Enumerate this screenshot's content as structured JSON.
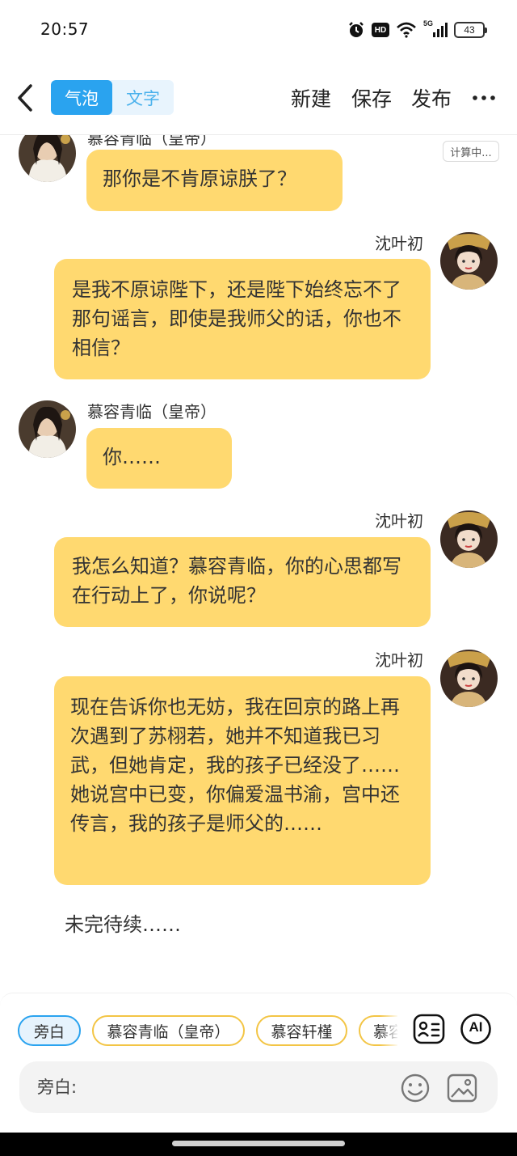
{
  "status_bar": {
    "time": "20:57",
    "network": "5G",
    "hd": "HD",
    "battery": "43"
  },
  "header": {
    "tabs": [
      {
        "label": "气泡",
        "active": true
      },
      {
        "label": "文字",
        "active": false
      }
    ],
    "new_label": "新建",
    "save_label": "保存",
    "publish_label": "发布",
    "accent_color": "#2aa3ef"
  },
  "chat": {
    "status_chip": "计算中...",
    "messages": [
      {
        "speaker": "慕容青临（皇帝）",
        "side": "left",
        "text": "那你是不肯原谅朕了？"
      },
      {
        "speaker": "沈叶初",
        "side": "right",
        "text": "是我不原谅陛下，还是陛下始终忘不了那句谣言，即使是我师父的话，你也不相信？"
      },
      {
        "speaker": "慕容青临（皇帝）",
        "side": "left",
        "text": "你……"
      },
      {
        "speaker": "沈叶初",
        "side": "right",
        "text": "我怎么知道？慕容青临，你的心思都写在行动上了，你说呢？"
      },
      {
        "speaker": "沈叶初",
        "side": "right",
        "text": "现在告诉你也无妨，我在回京的路上再次遇到了苏栩若，她并不知道我已习武，但她肯定，我的孩子已经没了……她说宫中已变，你偏爱温书渝，宫中还传言，我的孩子是师父的……"
      }
    ],
    "narration": "未完待续……",
    "bubble_color": "#ffd970"
  },
  "bottom": {
    "roles": [
      {
        "label": "旁白",
        "active": true
      },
      {
        "label": "慕容青临（皇帝）",
        "active": false
      },
      {
        "label": "慕容轩槿",
        "active": false
      },
      {
        "label": "慕容",
        "active": false
      }
    ],
    "role_card_icon": "contact-card-icon",
    "ai_label": "AI",
    "input_placeholder": "旁白:",
    "emoji_icon": "smiley-icon",
    "image_icon": "image-icon"
  }
}
